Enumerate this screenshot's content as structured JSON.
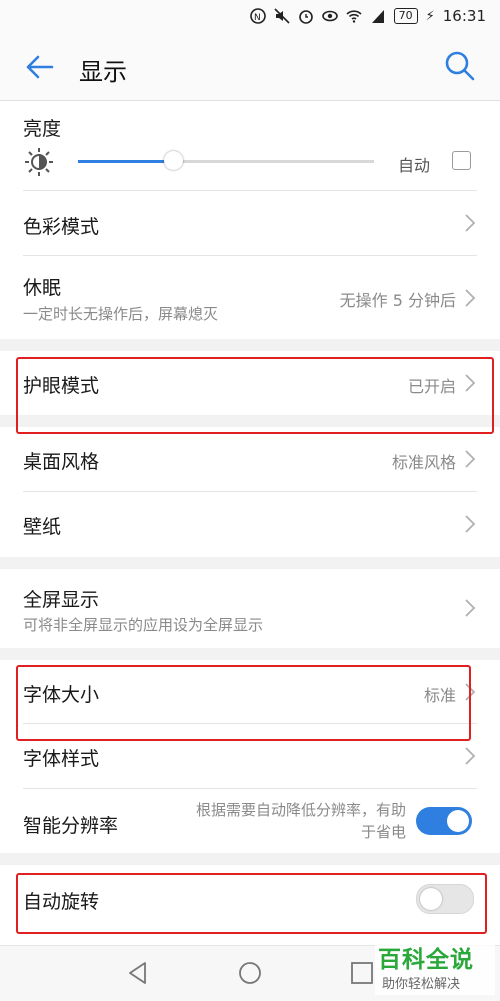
{
  "status": {
    "time": "16:31",
    "battery": "70",
    "net": "4G"
  },
  "header": {
    "title": "显示"
  },
  "brightness": {
    "label": "亮度",
    "auto_label": "自动",
    "level": 0.32,
    "auto_checked": false
  },
  "color_mode": {
    "label": "色彩模式"
  },
  "sleep": {
    "label": "休眠",
    "sub": "一定时长无操作后，屏幕熄灭",
    "value": "无操作 5 分钟后"
  },
  "eye_comfort": {
    "label": "护眼模式",
    "value": "已开启"
  },
  "home_style": {
    "label": "桌面风格",
    "value": "标准风格"
  },
  "wallpaper": {
    "label": "壁纸"
  },
  "fullscreen": {
    "label": "全屏显示",
    "sub": "可将非全屏显示的应用设为全屏显示"
  },
  "font_size": {
    "label": "字体大小",
    "value": "标准"
  },
  "font_style": {
    "label": "字体样式"
  },
  "smart_res": {
    "label": "智能分辨率",
    "desc_line1": "根据需要自动降低分辨率，有助",
    "desc_line2": "于省电",
    "on": true
  },
  "auto_rotate": {
    "label": "自动旋转",
    "on": false
  },
  "watermark": {
    "title": "百科全说",
    "sub": "助你轻松解决"
  },
  "colors": {
    "accent": "#2f7fe0",
    "highlight_box": "#e02020",
    "watermark": "#2aa83a"
  }
}
